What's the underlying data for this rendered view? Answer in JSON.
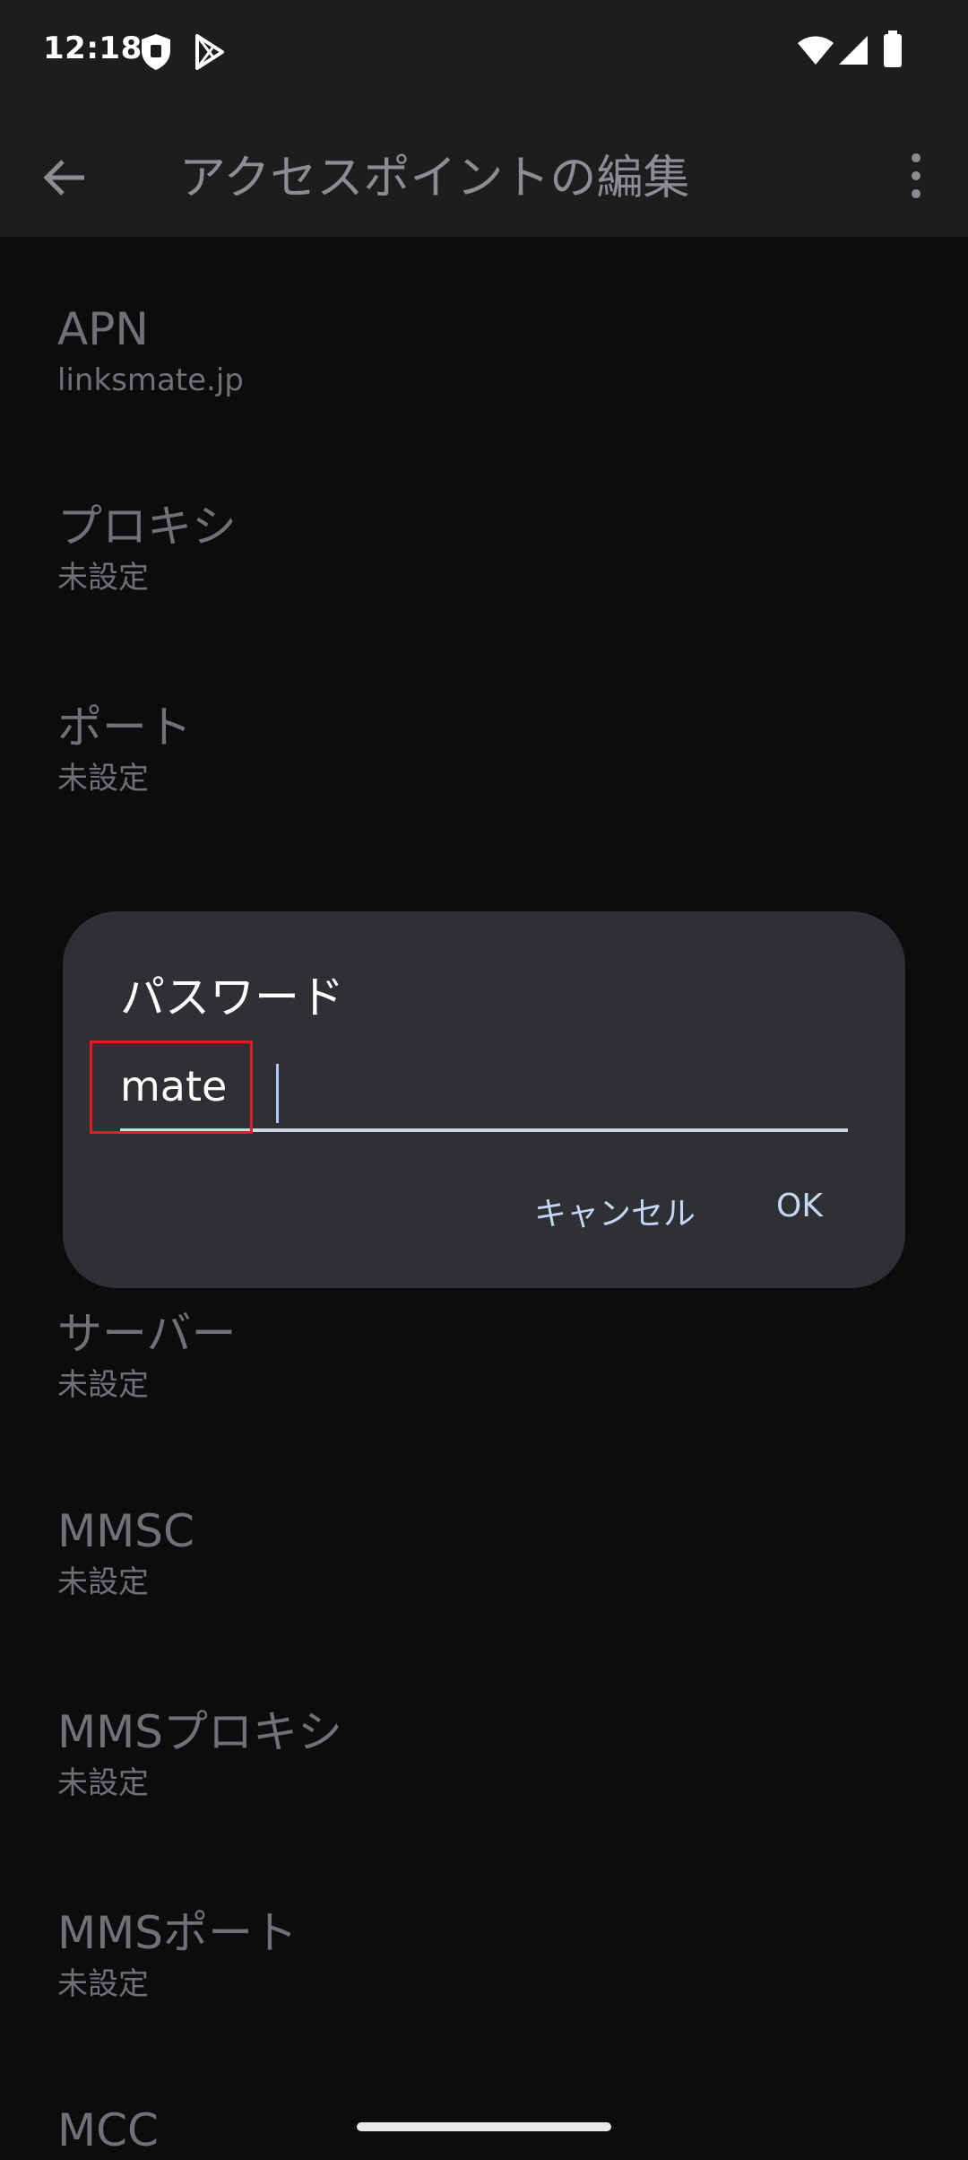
{
  "status_bar": {
    "time": "12:18",
    "icons": [
      "shield-app-icon",
      "play-store-icon",
      "wifi-icon",
      "cellular-signal-icon",
      "battery-icon"
    ]
  },
  "app_bar": {
    "back_icon": "arrow-left-icon",
    "title": "アクセスポイントの編集",
    "menu_icon": "more-vertical-icon"
  },
  "settings": [
    {
      "title": "APN",
      "value": "linksmate.jp"
    },
    {
      "title": "プロキシ",
      "value": "未設定"
    },
    {
      "title": "ポート",
      "value": "未設定"
    },
    {
      "title": "サーバー",
      "value": "未設定"
    },
    {
      "title": "MMSC",
      "value": "未設定"
    },
    {
      "title": "MMSプロキシ",
      "value": "未設定"
    },
    {
      "title": "MMSポート",
      "value": "未設定"
    },
    {
      "title": "MCC",
      "value": ""
    }
  ],
  "dialog": {
    "title": "パスワード",
    "input_value": "mate",
    "cancel_label": "キャンセル",
    "ok_label": "OK"
  },
  "colors": {
    "background": "#0b0c0e",
    "app_bar": "#1c1d1f",
    "dialog": "#2e3034",
    "accent": "#c6d6f5",
    "highlight": "#e01b24"
  }
}
